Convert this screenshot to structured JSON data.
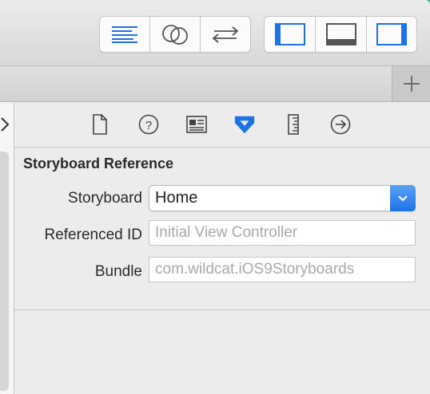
{
  "toolbar": {
    "editor_buttons": [
      {
        "name": "standard-editor-icon"
      },
      {
        "name": "assistant-editor-icon"
      },
      {
        "name": "version-editor-icon"
      }
    ],
    "view_buttons": [
      {
        "name": "navigator-panel-icon"
      },
      {
        "name": "debug-area-icon"
      },
      {
        "name": "utilities-panel-icon"
      }
    ]
  },
  "tabbar": {
    "add_icon": "plus-icon"
  },
  "inspector": {
    "tabs": [
      {
        "name": "file-inspector-icon"
      },
      {
        "name": "quick-help-icon"
      },
      {
        "name": "identity-inspector-icon"
      },
      {
        "name": "attributes-inspector-icon",
        "selected": true
      },
      {
        "name": "size-inspector-icon"
      },
      {
        "name": "connections-inspector-icon"
      }
    ],
    "section_title": "Storyboard Reference",
    "storyboard": {
      "label": "Storyboard",
      "value": "Home"
    },
    "referenced_id": {
      "label": "Referenced ID",
      "placeholder": "Initial View Controller",
      "value": ""
    },
    "bundle": {
      "label": "Bundle",
      "placeholder": "com.wildcat.iOS9Storyboards",
      "value": ""
    }
  },
  "colors": {
    "accent": "#1d72e6",
    "toolbar_bg": "#ececec",
    "teal_edge": "#3ab08a"
  }
}
